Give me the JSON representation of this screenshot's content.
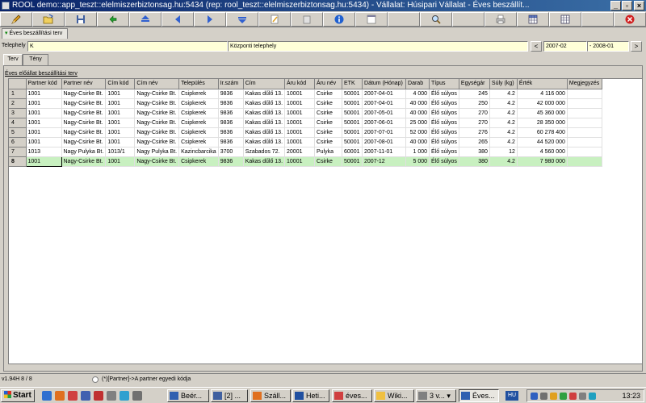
{
  "window": {
    "title": "ROOL demo::app_teszt::elelmiszerbiztonsag.hu:5434 (rep: rool_teszt::elelmiszerbiztonsag.hu:5434) - Vállalat: Húsipari Vállalat - Éves beszállít..."
  },
  "toolbar": {
    "buttons": [
      {
        "icon": "pencil-icon"
      },
      {
        "icon": "open-folder-icon"
      },
      {
        "icon": "save-disk-icon"
      },
      {
        "icon": "undo-arrow-icon"
      },
      {
        "icon": "first-record-icon"
      },
      {
        "icon": "previous-record-icon"
      },
      {
        "icon": "next-record-icon"
      },
      {
        "icon": "last-record-icon"
      },
      {
        "icon": "edit-icon"
      },
      {
        "icon": "info-icon"
      },
      {
        "icon": "form-view-icon"
      },
      {
        "icon": "search-icon"
      },
      {
        "icon": "print-icon"
      },
      {
        "icon": "table-view-icon"
      },
      {
        "icon": "grid-settings-icon"
      },
      {
        "icon": "close-icon"
      }
    ]
  },
  "doc_tab": {
    "label": "Éves beszállítási terv"
  },
  "filter": {
    "telephely_label": "Telephely",
    "telephely_code": "K",
    "telephely_name": "Központi telephely",
    "prev_label": "<",
    "next_label": ">",
    "date_from": "2007-02",
    "date_to": "- 2008-01"
  },
  "subtabs": [
    {
      "label": "Terv"
    },
    {
      "label": "Tény"
    }
  ],
  "panel": {
    "label": "Éves előállat beszállítási terv"
  },
  "grid": {
    "columns": [
      "Partner kód",
      "Partner név",
      "Cím kód",
      "Cím név",
      "Település",
      "Ir.szám",
      "Cím",
      "Áru kód",
      "Áru név",
      "ETK",
      "Dátum (Hónap)",
      "Darab",
      "Típus",
      "Egységár",
      "Súly (kg)",
      "Érték",
      "Megjegyzés"
    ],
    "rows": [
      {
        "num": "1",
        "cells": [
          "1001",
          "Nagy-Csirke Bt.",
          "1001",
          "Nagy-Csirke Bt.",
          "Csipkerek",
          "9836",
          "Kakas dűlő 13.",
          "10001",
          "Csirke",
          "50001",
          "2007-04-01",
          "4 000",
          "Élő súlyos",
          "245",
          "4.2",
          "4 116 000",
          ""
        ]
      },
      {
        "num": "2",
        "cells": [
          "1001",
          "Nagy-Csirke Bt.",
          "1001",
          "Nagy-Csirke Bt.",
          "Csipkerek",
          "9836",
          "Kakas dűlő 13.",
          "10001",
          "Csirke",
          "50001",
          "2007-04-01",
          "40 000",
          "Élő súlyos",
          "250",
          "4.2",
          "42 000 000",
          ""
        ]
      },
      {
        "num": "3",
        "cells": [
          "1001",
          "Nagy-Csirke Bt.",
          "1001",
          "Nagy-Csirke Bt.",
          "Csipkerek",
          "9836",
          "Kakas dűlő 13.",
          "10001",
          "Csirke",
          "50001",
          "2007-05-01",
          "40 000",
          "Élő súlyos",
          "270",
          "4.2",
          "45 360 000",
          ""
        ]
      },
      {
        "num": "4",
        "cells": [
          "1001",
          "Nagy-Csirke Bt.",
          "1001",
          "Nagy-Csirke Bt.",
          "Csipkerek",
          "9836",
          "Kakas dűlő 13.",
          "10001",
          "Csirke",
          "50001",
          "2007-06-01",
          "25 000",
          "Élő súlyos",
          "270",
          "4.2",
          "28 350 000",
          ""
        ]
      },
      {
        "num": "5",
        "cells": [
          "1001",
          "Nagy-Csirke Bt.",
          "1001",
          "Nagy-Csirke Bt.",
          "Csipkerek",
          "9836",
          "Kakas dűlő 13.",
          "10001",
          "Csirke",
          "50001",
          "2007-07-01",
          "52 000",
          "Élő súlyos",
          "276",
          "4.2",
          "60 278 400",
          ""
        ]
      },
      {
        "num": "6",
        "cells": [
          "1001",
          "Nagy-Csirke Bt.",
          "1001",
          "Nagy-Csirke Bt.",
          "Csipkerek",
          "9836",
          "Kakas dűlő 13.",
          "10001",
          "Csirke",
          "50001",
          "2007-08-01",
          "40 000",
          "Élő súlyos",
          "265",
          "4.2",
          "44 520 000",
          ""
        ]
      },
      {
        "num": "7",
        "cells": [
          "1013",
          "Nagy Pulyka Bt.",
          "1013/1",
          "Nagy Pulyka Bt.",
          "Kazincbarcika",
          "3700",
          "Szabados 72.",
          "20001",
          "Pulyka",
          "60001",
          "2007-11-01",
          "1 000",
          "Élő súlyos",
          "380",
          "12",
          "4 560 000",
          ""
        ]
      },
      {
        "num": "8",
        "cells": [
          "1001",
          "Nagy-Csirke Bt.",
          "1001",
          "Nagy-Csirke Bt.",
          "Csipkerek",
          "9836",
          "Kakas dűlő 13.",
          "10001",
          "Csirke",
          "50001",
          "2007-12",
          "5 000",
          "Élő súlyos",
          "380",
          "4.2",
          "7 980 000",
          ""
        ]
      }
    ],
    "selected_row": 7
  },
  "status": {
    "left": "v1.94H  8 / 8",
    "hint": "(*)[Partner]->A partner egyedi kódja"
  },
  "taskbar": {
    "start_label": "Start",
    "tasks": [
      {
        "label": "Beér..."
      },
      {
        "label": "[2] ..."
      },
      {
        "label": "Száll..."
      },
      {
        "label": "Heti..."
      },
      {
        "label": "éves..."
      },
      {
        "label": "Wiki..."
      },
      {
        "label": "3 v..."
      },
      {
        "label": "Éves..."
      }
    ],
    "language": "HU",
    "clock": "13:23"
  }
}
